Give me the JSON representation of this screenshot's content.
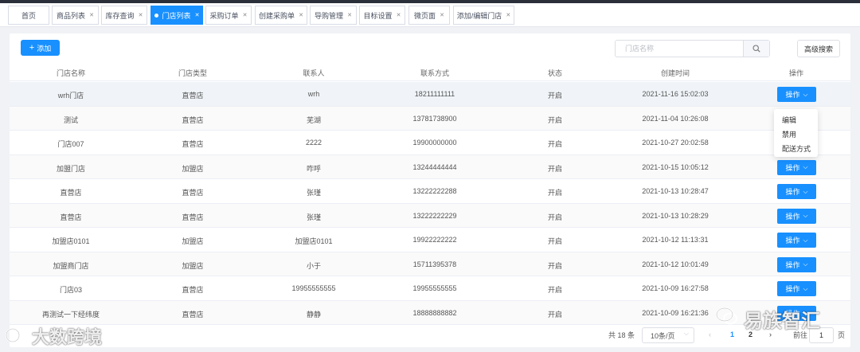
{
  "tabs": [
    {
      "label": "首页",
      "closable": false,
      "active": false
    },
    {
      "label": "商品列表",
      "closable": true,
      "active": false
    },
    {
      "label": "库存查询",
      "closable": true,
      "active": false
    },
    {
      "label": "门店列表",
      "closable": true,
      "active": true
    },
    {
      "label": "采购订单",
      "closable": true,
      "active": false
    },
    {
      "label": "创建采购单",
      "closable": true,
      "active": false
    },
    {
      "label": "导购管理",
      "closable": true,
      "active": false
    },
    {
      "label": "目标设置",
      "closable": true,
      "active": false
    },
    {
      "label": "微页面",
      "closable": true,
      "active": false
    },
    {
      "label": "添加/编辑门店",
      "closable": true,
      "active": false
    }
  ],
  "toolbar": {
    "add_label": "添加",
    "search_placeholder": "门店名称",
    "advanced_search_label": "高级搜索"
  },
  "table": {
    "columns": [
      "门店名称",
      "门店类型",
      "联系人",
      "联系方式",
      "状态",
      "创建时间",
      "操作"
    ],
    "action_label": "操作",
    "rows": [
      {
        "name": "wrh门店",
        "type": "直营店",
        "contact": "wrh",
        "phone": "18211111111",
        "status": "开启",
        "created": "2021-11-16 15:02:03"
      },
      {
        "name": "测试",
        "type": "直营店",
        "contact": "芜湖",
        "phone": "13781738900",
        "status": "开启",
        "created": "2021-11-04 10:26:08"
      },
      {
        "name": "门店007",
        "type": "直营店",
        "contact": "2222",
        "phone": "19900000000",
        "status": "开启",
        "created": "2021-10-27 20:02:58"
      },
      {
        "name": "加盟门店",
        "type": "加盟店",
        "contact": "咋呼",
        "phone": "13244444444",
        "status": "开启",
        "created": "2021-10-15 10:05:12"
      },
      {
        "name": "直营店",
        "type": "直营店",
        "contact": "张瑾",
        "phone": "13222222288",
        "status": "开启",
        "created": "2021-10-13 10:28:47"
      },
      {
        "name": "直营店",
        "type": "直营店",
        "contact": "张瑾",
        "phone": "13222222229",
        "status": "开启",
        "created": "2021-10-13 10:28:29"
      },
      {
        "name": "加盟店0101",
        "type": "加盟店",
        "contact": "加盟店0101",
        "phone": "19922222222",
        "status": "开启",
        "created": "2021-10-12 11:13:31"
      },
      {
        "name": "加盟商门店",
        "type": "加盟店",
        "contact": "小于",
        "phone": "15711395378",
        "status": "开启",
        "created": "2021-10-12 10:01:49"
      },
      {
        "name": "门店03",
        "type": "直营店",
        "contact": "19955555555",
        "phone": "19955555555",
        "status": "开启",
        "created": "2021-10-09 16:27:58"
      },
      {
        "name": "再测试一下经纬度",
        "type": "直营店",
        "contact": "静静",
        "phone": "18888888882",
        "status": "开启",
        "created": "2021-10-09 16:21:36"
      }
    ]
  },
  "dropdown": {
    "items": [
      "编辑",
      "禁用",
      "配送方式"
    ]
  },
  "pagination": {
    "total_text": "共 18 条",
    "page_size": "10条/页",
    "pages": [
      "1",
      "2"
    ],
    "current_page": "1",
    "goto_label": "前往",
    "goto_value": "1",
    "page_suffix": "页"
  },
  "watermarks": {
    "left": "大数跨境",
    "right": "易族智汇"
  },
  "colors": {
    "primary": "#1890ff",
    "topbar": "#2b2f3a"
  }
}
